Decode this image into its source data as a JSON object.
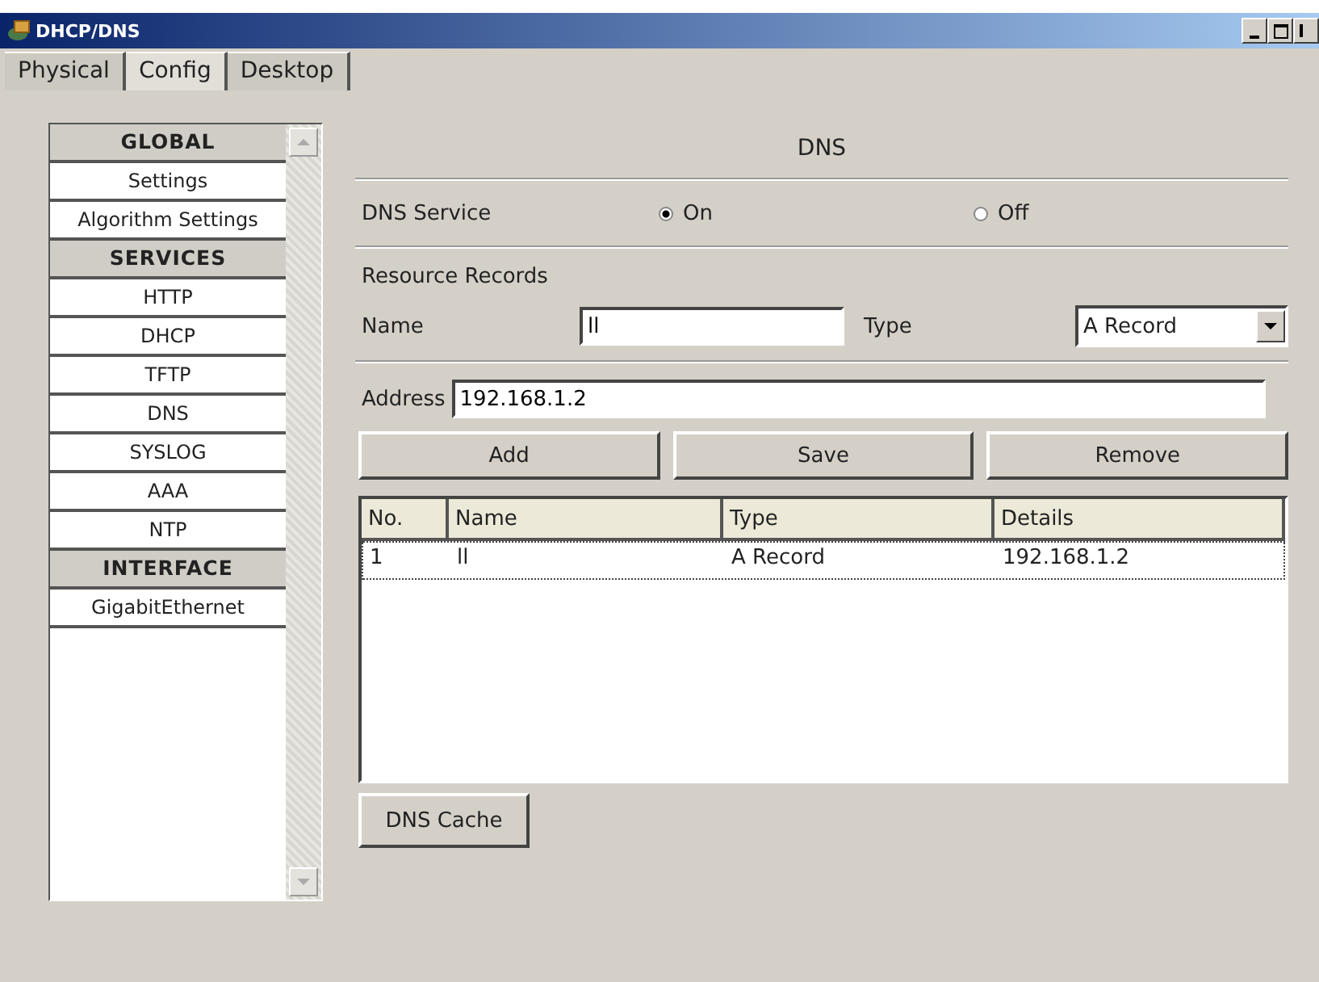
{
  "window": {
    "title": "DHCP/DNS"
  },
  "tabs": [
    {
      "label": "Physical",
      "selected": false
    },
    {
      "label": "Config",
      "selected": true
    },
    {
      "label": "Desktop",
      "selected": false
    }
  ],
  "sidebar": {
    "items": [
      {
        "kind": "header",
        "label": "GLOBAL"
      },
      {
        "kind": "item",
        "label": "Settings"
      },
      {
        "kind": "item",
        "label": "Algorithm Settings"
      },
      {
        "kind": "header",
        "label": "SERVICES"
      },
      {
        "kind": "item",
        "label": "HTTP"
      },
      {
        "kind": "item",
        "label": "DHCP"
      },
      {
        "kind": "item",
        "label": "TFTP"
      },
      {
        "kind": "item",
        "label": "DNS"
      },
      {
        "kind": "item",
        "label": "SYSLOG"
      },
      {
        "kind": "item",
        "label": "AAA"
      },
      {
        "kind": "item",
        "label": "NTP"
      },
      {
        "kind": "header",
        "label": "INTERFACE"
      },
      {
        "kind": "item",
        "label": "GigabitEthernet"
      }
    ]
  },
  "panel": {
    "title": "DNS",
    "service": {
      "label": "DNS Service",
      "options": [
        {
          "label": "On",
          "selected": true
        },
        {
          "label": "Off",
          "selected": false
        }
      ]
    },
    "section_label": "Resource Records",
    "name": {
      "label": "Name",
      "value": "ll"
    },
    "type": {
      "label": "Type",
      "value": "A Record"
    },
    "address": {
      "label": "Address",
      "value": "192.168.1.2"
    },
    "buttons": [
      "Add",
      "Save",
      "Remove"
    ],
    "table": {
      "columns": [
        "No.",
        "Name",
        "Type",
        "Details"
      ],
      "rows": [
        {
          "cells": [
            "1",
            "ll",
            "A Record",
            "192.168.1.2"
          ],
          "selected": true
        }
      ]
    },
    "cache_button": "DNS Cache"
  }
}
